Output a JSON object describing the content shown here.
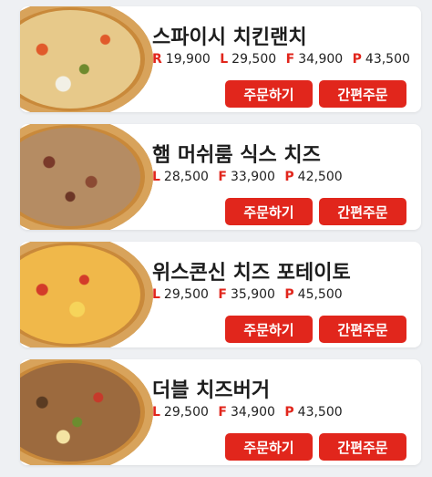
{
  "colors": {
    "accent": "#e1261c",
    "background": "#eef0f3",
    "card": "#ffffff"
  },
  "buttons": {
    "order": "주문하기",
    "quick": "간편주문"
  },
  "items": [
    {
      "name": "스파이시 치킨랜치",
      "prices": [
        {
          "size": "R",
          "price": "19,900"
        },
        {
          "size": "L",
          "price": "29,500"
        },
        {
          "size": "F",
          "price": "34,900"
        },
        {
          "size": "P",
          "price": "43,500"
        }
      ]
    },
    {
      "name": "햄 머쉬룸 식스 치즈",
      "prices": [
        {
          "size": "L",
          "price": "28,500"
        },
        {
          "size": "F",
          "price": "33,900"
        },
        {
          "size": "P",
          "price": "42,500"
        }
      ]
    },
    {
      "name": "위스콘신 치즈 포테이토",
      "prices": [
        {
          "size": "L",
          "price": "29,500"
        },
        {
          "size": "F",
          "price": "35,900"
        },
        {
          "size": "P",
          "price": "45,500"
        }
      ]
    },
    {
      "name": "더블 치즈버거",
      "prices": [
        {
          "size": "L",
          "price": "29,500"
        },
        {
          "size": "F",
          "price": "34,900"
        },
        {
          "size": "P",
          "price": "43,500"
        }
      ]
    }
  ]
}
